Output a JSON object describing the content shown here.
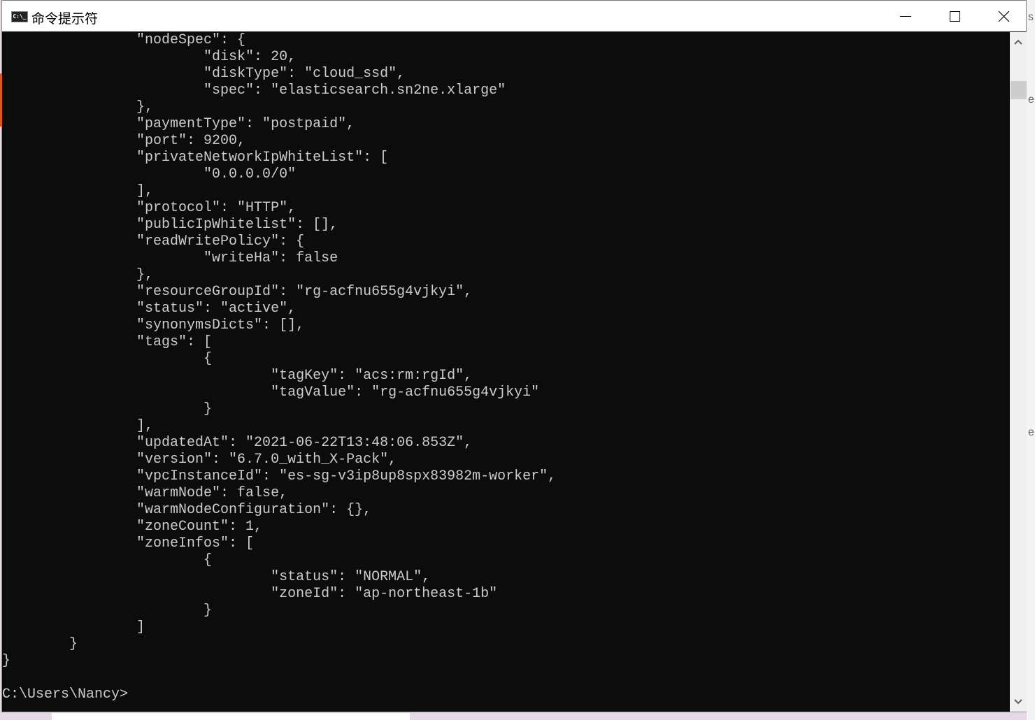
{
  "window": {
    "title": "命令提示符",
    "icon": "cmd-icon",
    "icon_text": "C:\\_"
  },
  "controls": [
    "minimize-icon",
    "maximize-icon",
    "close-icon"
  ],
  "colors": {
    "terminal_bg": "#0c0c0c",
    "terminal_text": "#cccccc"
  },
  "terminal": {
    "lines": [
      "\t\t\"nodeSpec\": {",
      "\t\t\t\"disk\": 20,",
      "\t\t\t\"diskType\": \"cloud_ssd\",",
      "\t\t\t\"spec\": \"elasticsearch.sn2ne.xlarge\"",
      "\t\t},",
      "\t\t\"paymentType\": \"postpaid\",",
      "\t\t\"port\": 9200,",
      "\t\t\"privateNetworkIpWhiteList\": [",
      "\t\t\t\"0.0.0.0/0\"",
      "\t\t],",
      "\t\t\"protocol\": \"HTTP\",",
      "\t\t\"publicIpWhitelist\": [],",
      "\t\t\"readWritePolicy\": {",
      "\t\t\t\"writeHa\": false",
      "\t\t},",
      "\t\t\"resourceGroupId\": \"rg-acfnu655g4vjkyi\",",
      "\t\t\"status\": \"active\",",
      "\t\t\"synonymsDicts\": [],",
      "\t\t\"tags\": [",
      "\t\t\t{",
      "\t\t\t\t\"tagKey\": \"acs:rm:rgId\",",
      "\t\t\t\t\"tagValue\": \"rg-acfnu655g4vjkyi\"",
      "\t\t\t}",
      "\t\t],",
      "\t\t\"updatedAt\": \"2021-06-22T13:48:06.853Z\",",
      "\t\t\"version\": \"6.7.0_with_X-Pack\",",
      "\t\t\"vpcInstanceId\": \"es-sg-v3ip8up8spx83982m-worker\",",
      "\t\t\"warmNode\": false,",
      "\t\t\"warmNodeConfiguration\": {},",
      "\t\t\"zoneCount\": 1,",
      "\t\t\"zoneInfos\": [",
      "\t\t\t{",
      "\t\t\t\t\"status\": \"NORMAL\",",
      "\t\t\t\t\"zoneId\": \"ap-northeast-1b\"",
      "\t\t\t}",
      "\t\t]",
      "\t}",
      "}",
      "",
      "C:\\Users\\Nancy>"
    ]
  },
  "background_fragments": [
    "s",
    "e",
    "e"
  ]
}
